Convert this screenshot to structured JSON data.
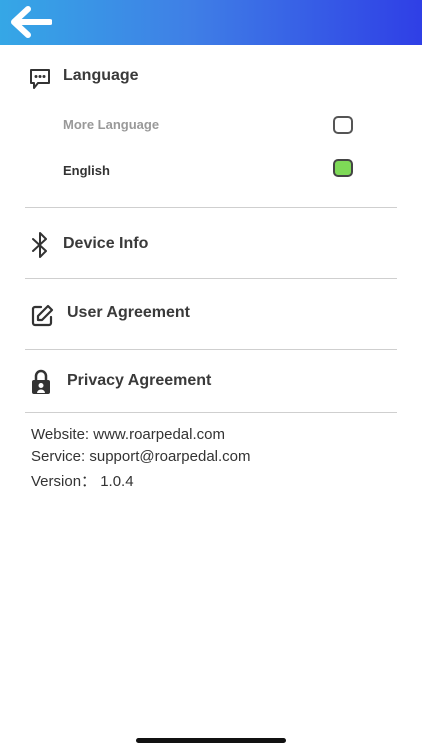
{
  "header": {
    "back_icon": "arrow-left-icon",
    "color_start": "#35a7e6",
    "color_end": "#2f3fe6"
  },
  "language": {
    "title": "Language",
    "icon": "chat-bubble-icon",
    "options": [
      {
        "label": "More Language",
        "checked": false
      },
      {
        "label": "English",
        "checked": true
      }
    ]
  },
  "device_info": {
    "title": "Device Info",
    "icon": "bluetooth-icon"
  },
  "user_agreement": {
    "title": "User Agreement",
    "icon": "edit-icon"
  },
  "privacy_agreement": {
    "title": "Privacy Agreement",
    "icon": "lock-icon"
  },
  "info": {
    "website": "Website: www.roarpedal.com",
    "service": "Service: support@roarpedal.com",
    "version": "Version：  1.0.4"
  },
  "colors": {
    "checked_fill": "#7ed957",
    "muted_text": "#999999"
  }
}
